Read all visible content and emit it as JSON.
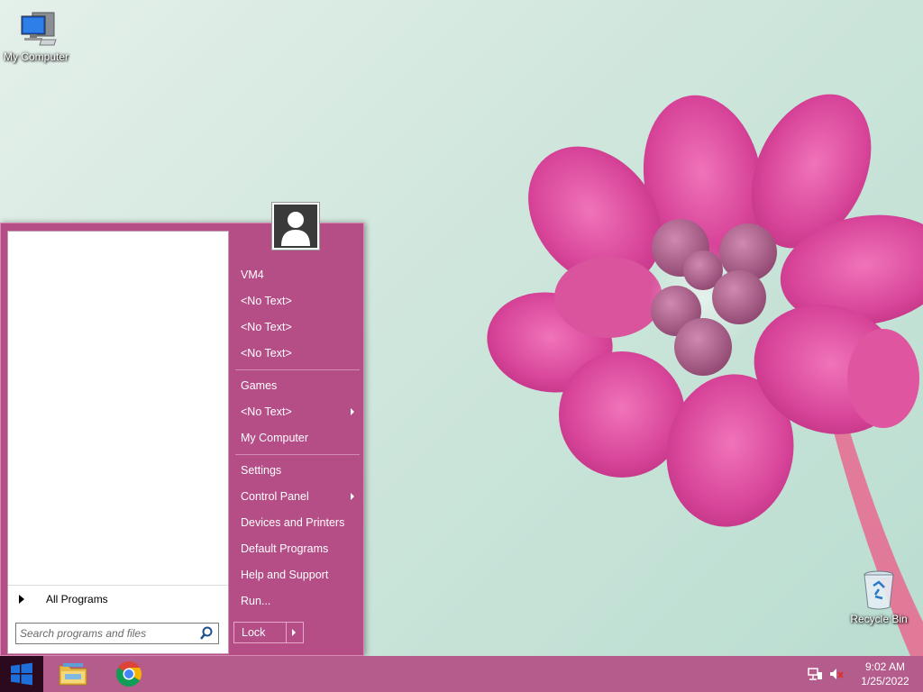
{
  "desktop": {
    "icons": [
      {
        "label": "My Computer",
        "icon": "computer-icon"
      },
      {
        "label": "Recycle Bin",
        "icon": "recycle-bin-icon"
      }
    ]
  },
  "start_menu": {
    "all_programs_label": "All Programs",
    "search_placeholder": "Search programs and files",
    "right_items": [
      {
        "label": "VM4",
        "submenu": false
      },
      {
        "label": "<No Text>",
        "submenu": false
      },
      {
        "label": "<No Text>",
        "submenu": false
      },
      {
        "label": "<No Text>",
        "submenu": false
      },
      {
        "label": "Games",
        "submenu": false
      },
      {
        "label": "<No Text>",
        "submenu": true
      },
      {
        "label": "My Computer",
        "submenu": false
      },
      {
        "label": "Settings",
        "submenu": false
      },
      {
        "label": "Control Panel",
        "submenu": true
      },
      {
        "label": "Devices and Printers",
        "submenu": false
      },
      {
        "label": "Default Programs",
        "submenu": false
      },
      {
        "label": "Help and Support",
        "submenu": false
      },
      {
        "label": "Run...",
        "submenu": false
      }
    ],
    "lock_label": "Lock"
  },
  "taskbar": {
    "apps": [
      {
        "icon": "file-explorer-icon"
      },
      {
        "icon": "chrome-icon"
      }
    ],
    "tray": {
      "icons": [
        "network-icon",
        "speaker-muted-icon"
      ],
      "time": "9:02 AM",
      "date": "1/25/2022"
    }
  },
  "colors": {
    "menu_bg": "#b54d86",
    "taskbar_bg": "#b45c8c",
    "start_button_bg": "#2b0a1e",
    "accent_blue": "#1e6fd9"
  }
}
